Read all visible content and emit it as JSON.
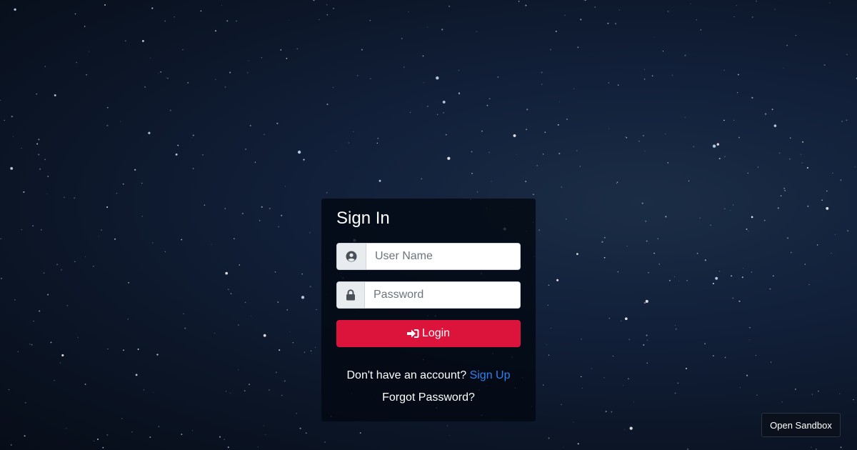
{
  "login_card": {
    "title": "Sign In",
    "username": {
      "icon": "user-circle-icon",
      "placeholder": "User Name",
      "value": ""
    },
    "password": {
      "icon": "lock-icon",
      "placeholder": "Password",
      "value": ""
    },
    "login_button": {
      "icon": "sign-in-icon",
      "label": "Login"
    },
    "signup_prompt": "Don't have an account?",
    "signup_link": "Sign Up",
    "forgot_password": "Forgot Password?"
  },
  "sandbox_button": {
    "label": "Open Sandbox"
  },
  "colors": {
    "login_button": "#dc143c",
    "signup_link": "#2f80ed",
    "card_background": "#030812",
    "addon_background": "#e9ecef"
  }
}
